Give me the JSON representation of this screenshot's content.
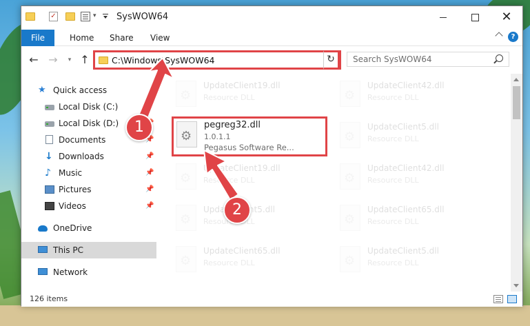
{
  "window": {
    "title": "SysWOW64"
  },
  "ribbon": {
    "tabs": [
      "File",
      "Home",
      "Share",
      "View"
    ]
  },
  "address": {
    "path": "C:\\Windows\\SysWOW64",
    "search_placeholder": "Search SysWOW64"
  },
  "nav": {
    "items": [
      {
        "label": "Quick access",
        "icon": "star-icon",
        "pinned": false
      },
      {
        "label": "Local Disk (C:)",
        "icon": "disk-icon",
        "pinned": false
      },
      {
        "label": "Local Disk (D:)",
        "icon": "disk-icon",
        "pinned": false
      },
      {
        "label": "Documents",
        "icon": "document-icon",
        "pinned": true
      },
      {
        "label": "Downloads",
        "icon": "download-icon",
        "pinned": true
      },
      {
        "label": "Music",
        "icon": "music-icon",
        "pinned": true
      },
      {
        "label": "Pictures",
        "icon": "pictures-icon",
        "pinned": true
      },
      {
        "label": "Videos",
        "icon": "video-icon",
        "pinned": true
      },
      {
        "label": "OneDrive",
        "icon": "cloud-icon",
        "pinned": false
      },
      {
        "label": "This PC",
        "icon": "computer-icon",
        "pinned": false,
        "selected": true
      },
      {
        "label": "Network",
        "icon": "network-icon",
        "pinned": false
      }
    ]
  },
  "files": {
    "left": [
      {
        "name": "UpdateClient19.dll",
        "type": "Resource DLL"
      },
      {
        "name": "UpdateClient19.dll",
        "type": "Resource DLL"
      },
      {
        "name": "UpdateClient5.dll",
        "type": "Resource DLL"
      },
      {
        "name": "UpdateClient65.dll",
        "type": "Resource DLL"
      }
    ],
    "right": [
      {
        "name": "UpdateClient42.dll",
        "type": "Resource DLL"
      },
      {
        "name": "UpdateClient5.dll",
        "type": "Resource DLL"
      },
      {
        "name": "UpdateClient42.dll",
        "type": "Resource DLL"
      },
      {
        "name": "UpdateClient65.dll",
        "type": "Resource DLL"
      },
      {
        "name": "UpdateClient5.dll",
        "type": "Resource DLL"
      }
    ],
    "highlighted": {
      "name": "pegreg32.dll",
      "version": "1.0.1.1",
      "company": "Pegasus Software Re..."
    }
  },
  "status": {
    "item_count": "126 items"
  },
  "annotations": {
    "step1": "1",
    "step2": "2"
  },
  "colors": {
    "accent": "#1979ca",
    "highlight_red": "#e04447"
  }
}
